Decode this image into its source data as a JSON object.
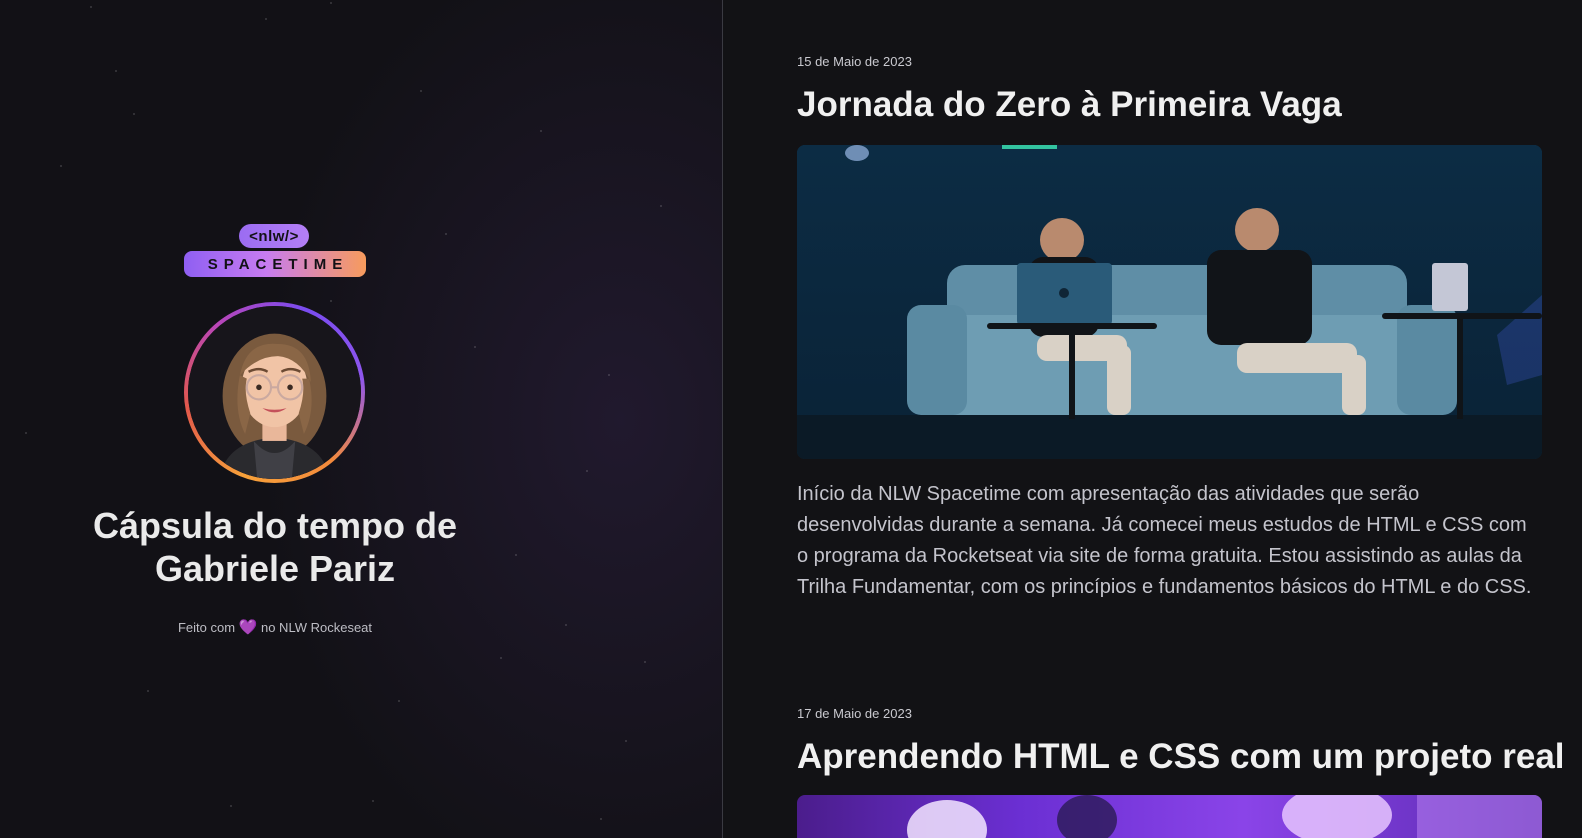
{
  "logo": {
    "top_text": "<nlw/>",
    "bottom_text": "SPACETIME"
  },
  "profile": {
    "avatar_label": "avatar"
  },
  "title": {
    "line1": "Cápsula do tempo de",
    "line2": "Gabriele Pariz"
  },
  "footer": {
    "prefix": "Feito com",
    "heart": "💜",
    "suffix": "no NLW Rockeseat"
  },
  "entries": [
    {
      "date": "15 de Maio de 2023",
      "title": "Jornada do Zero à Primeira Vaga",
      "text": "Início da NLW Spacetime com apresentação das atividades que serão desenvolvidas durante a semana. Já comecei meus estudos de HTML e CSS com o programa da Rocketseat via site de forma gratuita. Estou assistindo as aulas da Trilha Fundamentar, com os princípios e fundamentos básicos do HTML e do CSS."
    },
    {
      "date": "17 de Maio de 2023",
      "title": "Aprendendo HTML e CSS com um projeto real"
    }
  ],
  "colors": {
    "background": "#121215",
    "accent_purple": "#9b6cf2",
    "accent_orange": "#f79b5c",
    "text_primary": "#f0f0f0",
    "text_secondary": "#c4c4cc"
  }
}
